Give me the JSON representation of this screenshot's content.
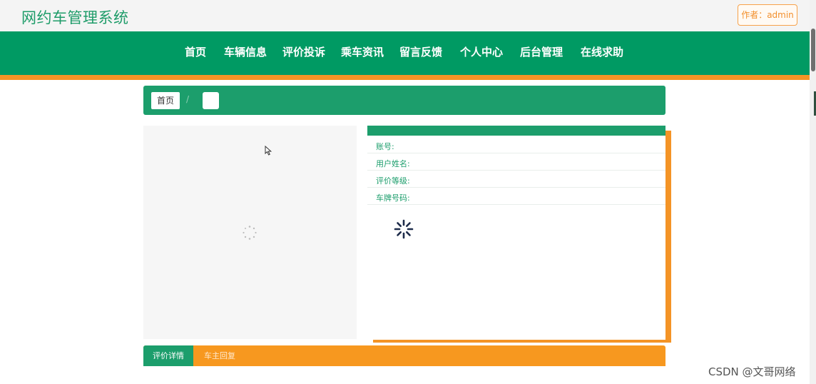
{
  "header": {
    "site_title": "网约车管理系统",
    "author_label": "作者：admin"
  },
  "nav": {
    "items": [
      "首页",
      "车辆信息",
      "评价投诉",
      "乘车资讯",
      "留言反馈",
      "个人中心",
      "后台管理",
      "在线求助"
    ]
  },
  "breadcrumb": {
    "home": "首页",
    "separator": "/",
    "current": ""
  },
  "detail": {
    "fields": [
      {
        "label": "账号:",
        "value": ""
      },
      {
        "label": "用户姓名:",
        "value": ""
      },
      {
        "label": "评价等级:",
        "value": ""
      },
      {
        "label": "车牌号码:",
        "value": ""
      }
    ]
  },
  "tabs": [
    "评价详情",
    "车主回复"
  ],
  "watermark": "CSDN @文哥网络",
  "colors": {
    "primary": "#009a63",
    "accent": "#f49426"
  },
  "icons": {
    "cursor": "mouse-pointer-icon",
    "loader": "spinner-icon"
  }
}
